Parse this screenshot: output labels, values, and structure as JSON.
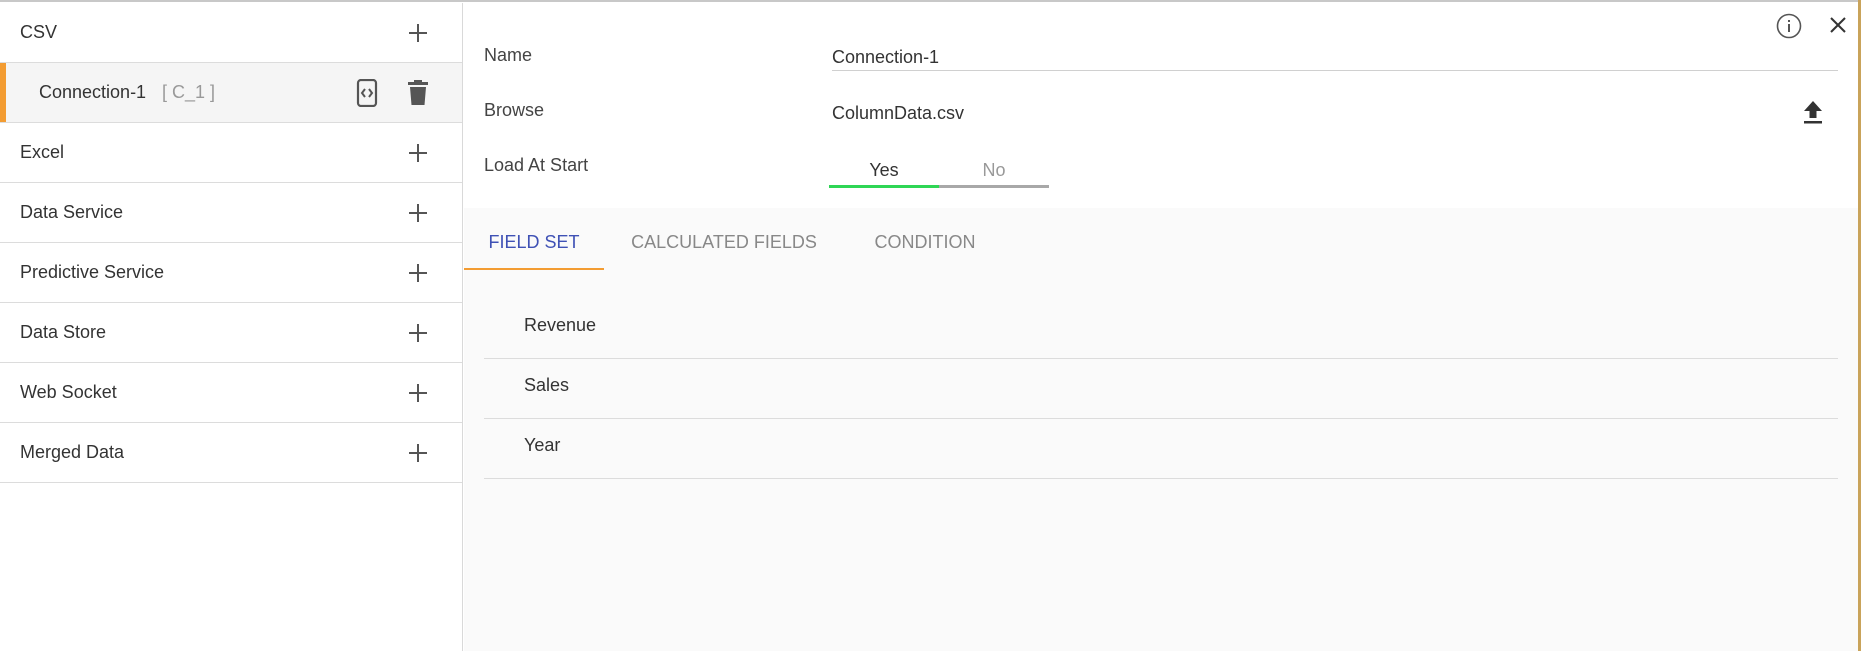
{
  "sidebar": {
    "items": [
      {
        "label": "CSV",
        "icon": "plus-icon"
      },
      {
        "label": "Excel",
        "icon": "plus-icon"
      },
      {
        "label": "Data Service",
        "icon": "plus-icon"
      },
      {
        "label": "Predictive Service",
        "icon": "plus-icon"
      },
      {
        "label": "Data Store",
        "icon": "plus-icon"
      },
      {
        "label": "Web Socket",
        "icon": "plus-icon"
      },
      {
        "label": "Merged Data",
        "icon": "plus-icon"
      }
    ],
    "connection": {
      "name": "Connection-1",
      "id": "[ C_1 ]",
      "accent_color": "#f39c32"
    }
  },
  "form": {
    "name_label": "Name",
    "name_value": "Connection-1",
    "browse_label": "Browse",
    "browse_value": "ColumnData.csv",
    "load_label": "Load At Start",
    "toggle": {
      "yes": "Yes",
      "no": "No",
      "selected": "Yes",
      "active_color": "#2fd655"
    }
  },
  "tabs": [
    {
      "label": "FIELD SET",
      "active": true
    },
    {
      "label": "CALCULATED FIELDS",
      "active": false
    },
    {
      "label": "CONDITION",
      "active": false
    }
  ],
  "fields": [
    "Revenue",
    "Sales",
    "Year"
  ],
  "colors": {
    "accent": "#f39c32",
    "tab_active": "#3f51b5"
  }
}
